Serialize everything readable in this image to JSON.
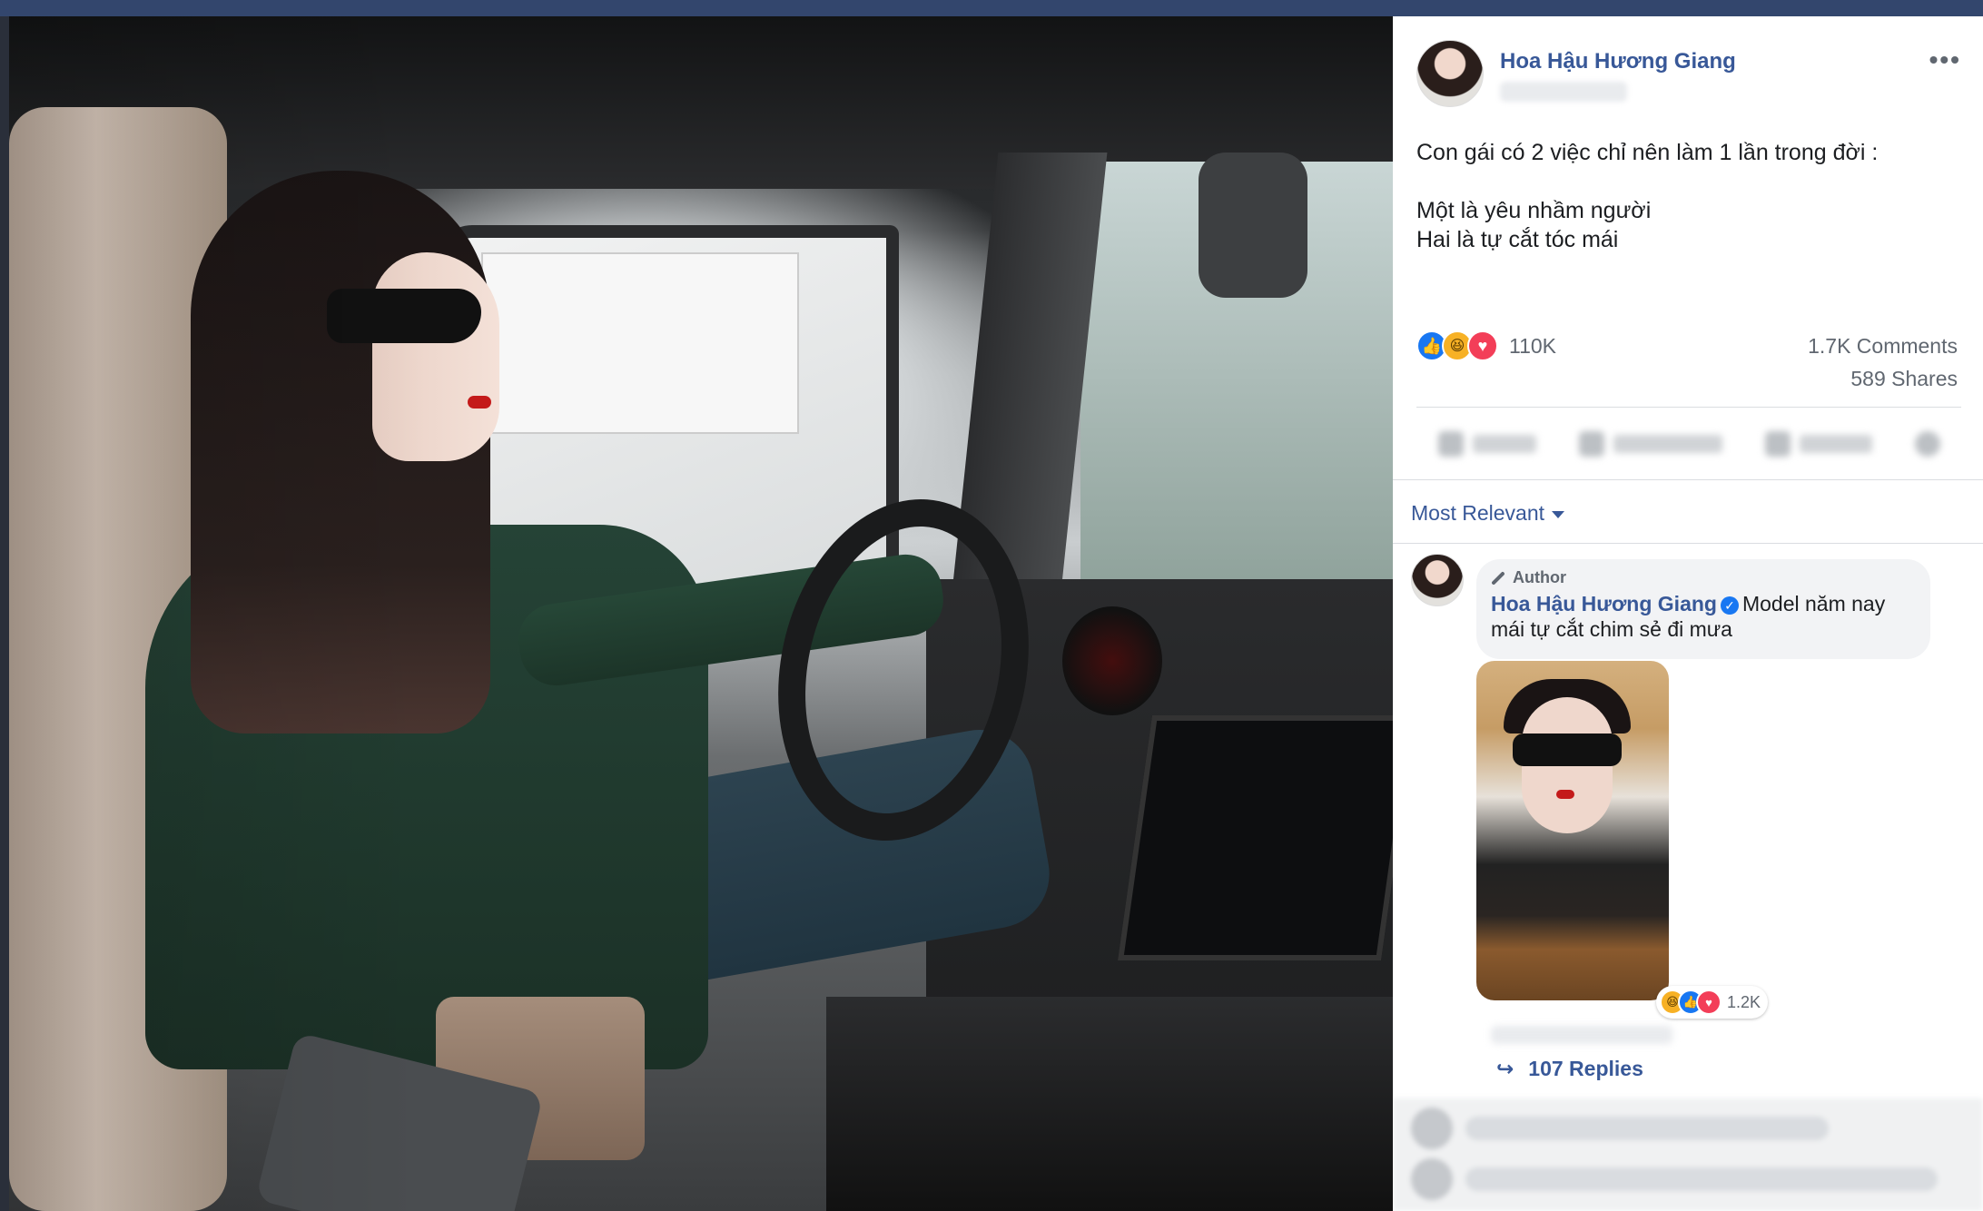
{
  "post": {
    "author": "Hoa Hậu Hương Giang",
    "more_label": "•••",
    "text_lines": [
      "Con gái có 2 việc chỉ nên làm 1 lần trong đời :",
      "Một là yêu nhầm người",
      "Hai là tự cắt tóc mái"
    ],
    "reactions_count": "110K",
    "reaction_icons": [
      "like-icon",
      "haha-icon",
      "love-icon"
    ],
    "comments_count": "1.7K Comments",
    "shares_count": "589 Shares"
  },
  "comments": {
    "sort_label": "Most Relevant",
    "top_comment": {
      "badge": "Author",
      "author": "Hoa Hậu Hương Giang",
      "text": "Model năm nay mái tự cắt chim sẻ đi mưa",
      "reaction_count": "1.2K",
      "reaction_icons": [
        "haha-icon",
        "like-icon",
        "love-icon"
      ]
    },
    "replies_label": "107 Replies"
  },
  "colors": {
    "link_blue": "#385898",
    "text": "#1c1e21",
    "meta": "#606770",
    "like": "#1877f2",
    "love": "#f33e58",
    "haha": "#f7b125"
  }
}
